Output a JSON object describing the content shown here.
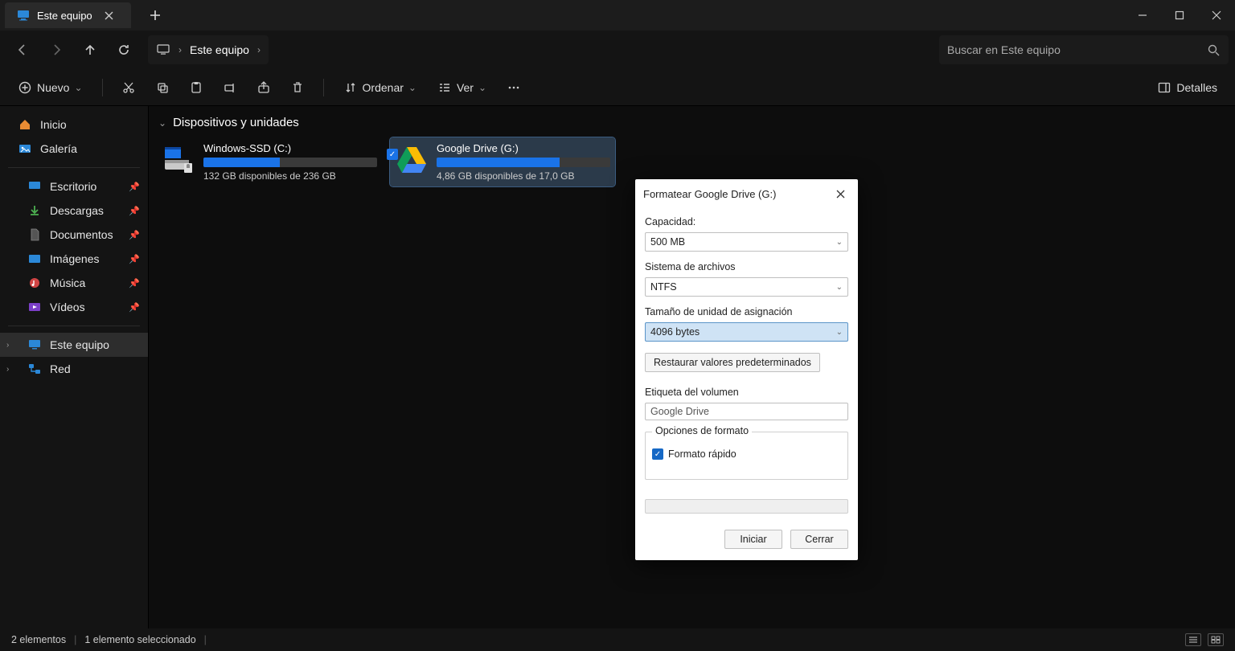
{
  "titlebar": {
    "tab_label": "Este equipo"
  },
  "breadcrumb": {
    "location": "Este equipo"
  },
  "search": {
    "placeholder": "Buscar en Este equipo"
  },
  "toolbar": {
    "new_label": "Nuevo",
    "sort_label": "Ordenar",
    "view_label": "Ver",
    "details_label": "Detalles"
  },
  "sidebar": {
    "home": "Inicio",
    "gallery": "Galería",
    "desktop": "Escritorio",
    "downloads": "Descargas",
    "documents": "Documentos",
    "pictures": "Imágenes",
    "music": "Música",
    "videos": "Vídeos",
    "thispc": "Este equipo",
    "network": "Red"
  },
  "content": {
    "section_title": "Dispositivos y unidades",
    "drive_c": {
      "name": "Windows-SSD (C:)",
      "sub": "132 GB disponibles de 236 GB",
      "fill_pct": 44
    },
    "drive_g": {
      "name": "Google Drive (G:)",
      "sub": "4,86 GB disponibles de 17,0 GB",
      "fill_pct": 71
    }
  },
  "statusbar": {
    "count": "2 elementos",
    "selected": "1 elemento seleccionado"
  },
  "dialog": {
    "title": "Formatear Google Drive (G:)",
    "capacity_label": "Capacidad:",
    "capacity_value": "500 MB",
    "fs_label": "Sistema de archivos",
    "fs_value": "NTFS",
    "alloc_label": "Tamaño de unidad de asignación",
    "alloc_value": "4096 bytes",
    "restore_label": "Restaurar valores predeterminados",
    "vol_label": "Etiqueta del volumen",
    "vol_value": "Google Drive",
    "options_label": "Opciones de formato",
    "quick_label": "Formato rápido",
    "start_label": "Iniciar",
    "close_label": "Cerrar"
  }
}
